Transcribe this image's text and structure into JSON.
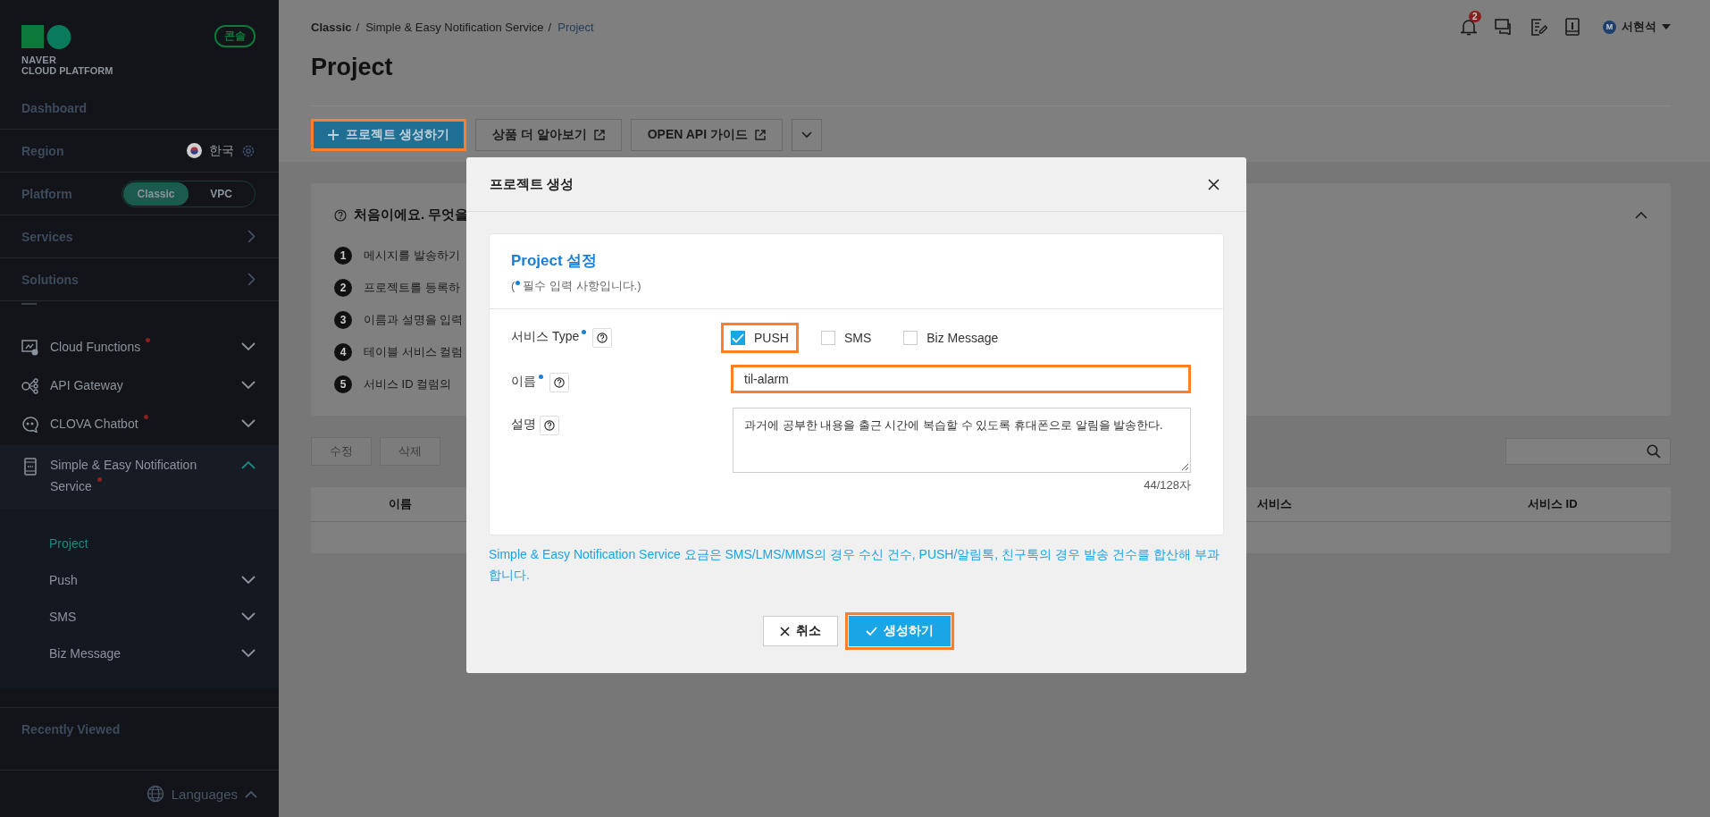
{
  "sidebar": {
    "logo": {
      "brand": "NAVER",
      "product": "CLOUD PLATFORM"
    },
    "console_badge": "콘솔",
    "dashboard": "Dashboard",
    "region": {
      "label": "Region",
      "value": "한국"
    },
    "platform": {
      "label": "Platform",
      "options": [
        {
          "label": "Classic",
          "selected": true
        },
        {
          "label": "VPC",
          "selected": false
        }
      ]
    },
    "sections": [
      {
        "label": "Services"
      },
      {
        "label": "Solutions"
      }
    ],
    "menu": [
      {
        "label": "Cloud Functions",
        "new": true,
        "expanded": false
      },
      {
        "label": "API Gateway",
        "new": false,
        "expanded": false
      },
      {
        "label": "CLOVA Chatbot",
        "new": true,
        "expanded": false
      },
      {
        "label": "Simple & Easy Notification Service",
        "new": true,
        "expanded": true,
        "children": [
          {
            "label": "Project",
            "selected": true,
            "expandable": false
          },
          {
            "label": "Push",
            "selected": false,
            "expandable": true
          },
          {
            "label": "SMS",
            "selected": false,
            "expandable": true
          },
          {
            "label": "Biz Message",
            "selected": false,
            "expandable": true
          }
        ]
      }
    ],
    "recently_viewed": "Recently Viewed",
    "languages": "Languages"
  },
  "header": {
    "breadcrumb": [
      {
        "label": "Classic",
        "separator": "/",
        "current": false
      },
      {
        "label": "Simple & Easy Notification Service",
        "separator": "/",
        "current": false
      },
      {
        "label": "Project",
        "current": true
      }
    ],
    "notification_count": "2",
    "user": {
      "initial": "M",
      "name": "서현석"
    }
  },
  "page": {
    "title": "Project",
    "actions": [
      {
        "label": "프로젝트 생성하기",
        "kind": "primary",
        "highlighted": true
      },
      {
        "label": "상품 더 알아보기",
        "kind": "external",
        "highlighted": false
      },
      {
        "label": "OPEN API 가이드",
        "kind": "external",
        "highlighted": false
      },
      {
        "kind": "more",
        "highlighted": false
      }
    ],
    "guide": {
      "title": "처음이에요. 무엇을",
      "expanded": true,
      "steps": [
        {
          "number": "1",
          "text": "메시지를 발송하기"
        },
        {
          "number": "2",
          "text": "프로젝트를 등록하"
        },
        {
          "number": "3",
          "text": "이름과 설명을 입력"
        },
        {
          "number": "4",
          "text": "테이블 서비스 컬럼"
        },
        {
          "number": "5",
          "text": "서비스 ID 컬럼의"
        }
      ]
    },
    "toolbar": [
      {
        "label": "수정",
        "disabled": true
      },
      {
        "label": "삭제",
        "disabled": true
      }
    ],
    "table": {
      "columns": [
        "이름",
        "서비스",
        "서비스 ID"
      ]
    }
  },
  "modal": {
    "title": "프로젝트 생성",
    "section_title": "Project 설정",
    "note_open": "(",
    "note_text": "필수 입력 사항입니다.)",
    "fields": [
      {
        "kind": "checkboxes",
        "label": "서비스 Type",
        "required": true,
        "options": [
          {
            "label": "PUSH",
            "checked": true,
            "highlighted": true
          },
          {
            "label": "SMS",
            "checked": false,
            "highlighted": false
          },
          {
            "label": "Biz Message",
            "checked": false,
            "highlighted": false
          }
        ]
      },
      {
        "kind": "text",
        "label": "이름",
        "required": true,
        "value": "til-alarm",
        "highlighted": true
      },
      {
        "kind": "textarea",
        "label": "설명",
        "required": false,
        "value": "과거에 공부한 내용을 출근 시간에 복습할 수 있도록 휴대폰으로 알림을 발송한다.",
        "counter": "44/128자",
        "highlighted": false
      }
    ],
    "notice": "Simple & Easy Notification Service 요금은 SMS/LMS/MMS의 경우 수신 건수, PUSH/알림톡, 친구톡의 경우 발송 건수를 합산해 부과합니다.",
    "buttons": [
      {
        "label": "취소",
        "kind": "cancel",
        "highlighted": false
      },
      {
        "label": "생성하기",
        "kind": "confirm",
        "highlighted": true
      }
    ]
  }
}
